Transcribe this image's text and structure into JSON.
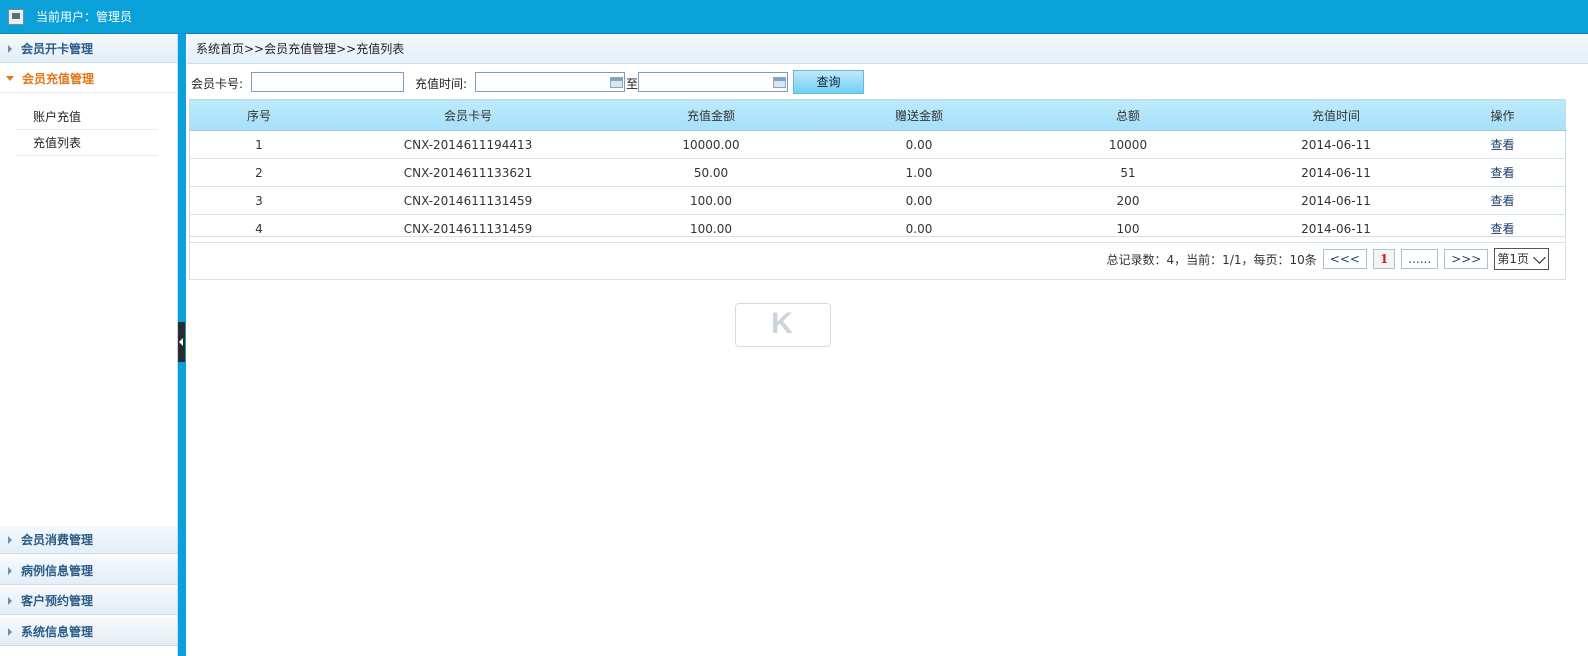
{
  "topbar": {
    "user_label": "当前用户：管理员"
  },
  "breadcrumb": "系统首页>>会员充值管理>>充值列表",
  "sidebar": {
    "menus": [
      {
        "label": "会员开卡管理",
        "active": false
      },
      {
        "label": "会员充值管理",
        "active": true,
        "items": [
          "账户充值",
          "充值列表"
        ]
      },
      {
        "label": "会员消费管理",
        "active": false
      },
      {
        "label": "病例信息管理",
        "active": false
      },
      {
        "label": "客户预约管理",
        "active": false
      },
      {
        "label": "系统信息管理",
        "active": false
      }
    ]
  },
  "search": {
    "card_label": "会员卡号:",
    "card_value": "",
    "time_label": "充值时间:",
    "start_value": "",
    "to_label": "至",
    "end_value": "",
    "button": "查询"
  },
  "table": {
    "headers": [
      "序号",
      "会员卡号",
      "充值金额",
      "赠送金额",
      "总额",
      "充值时间",
      "操作"
    ],
    "rows": [
      [
        "1",
        "CNX-2014611194413",
        "10000.00",
        "0.00",
        "10000",
        "2014-06-11",
        "查看"
      ],
      [
        "2",
        "CNX-2014611133621",
        "50.00",
        "1.00",
        "51",
        "2014-06-11",
        "查看"
      ],
      [
        "3",
        "CNX-2014611131459",
        "100.00",
        "0.00",
        "200",
        "2014-06-11",
        "查看"
      ],
      [
        "4",
        "CNX-2014611131459",
        "100.00",
        "0.00",
        "100",
        "2014-06-11",
        "查看"
      ]
    ]
  },
  "pager": {
    "summary": "总记录数：4，当前：1/1，每页：10条",
    "first": "<<<",
    "current": "1",
    "ellipsis": "......",
    "last": ">>>",
    "page_select": "第1页"
  },
  "watermark": "K"
}
